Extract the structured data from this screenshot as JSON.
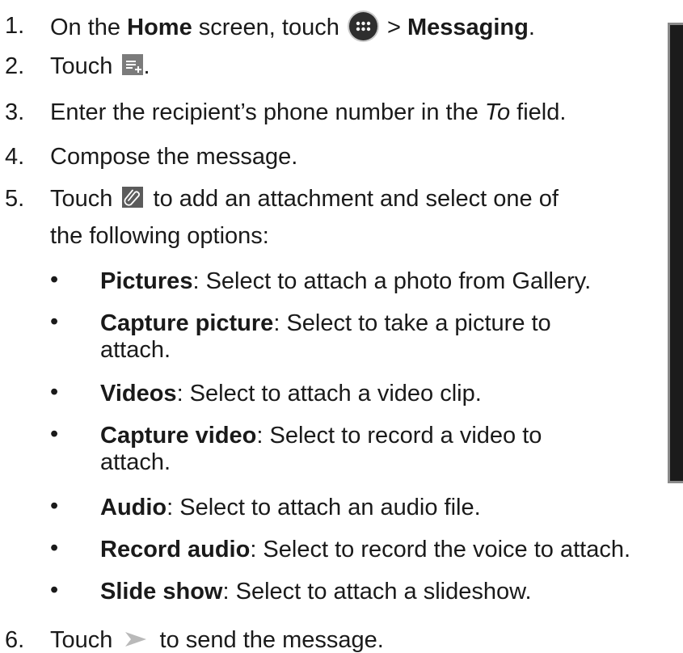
{
  "steps": [
    {
      "num": "1.",
      "pre": "On the ",
      "bold1": "Home",
      "mid": " screen, touch ",
      "after": " > ",
      "bold2": "Messaging",
      "end": "."
    },
    {
      "num": "2.",
      "pre": "Touch ",
      "end": "."
    },
    {
      "num": "3.",
      "pre": "Enter the recipient’s phone number in the ",
      "italic": "To",
      "end": " field."
    },
    {
      "num": "4.",
      "text": "Compose the message."
    },
    {
      "num": "5.",
      "pre": "Touch ",
      "post": " to add an attachment and select one of",
      "line2": "the following options:"
    },
    {
      "num": "6.",
      "pre": "Touch ",
      "post": " to send the message."
    }
  ],
  "bullet_char": "•",
  "options": [
    {
      "term": "Pictures",
      "desc": ": Select to attach a photo from Gallery."
    },
    {
      "term": "Capture picture",
      "desc": ": Select to take a picture to",
      "desc2": "attach."
    },
    {
      "term": "Videos",
      "desc": ": Select to attach a video clip."
    },
    {
      "term": "Capture video",
      "desc": ": Select to record a video to",
      "desc2": "attach."
    },
    {
      "term": "Audio",
      "desc": ": Select to attach an audio file."
    },
    {
      "term": "Record audio",
      "desc": ": Select to record the voice to attach."
    },
    {
      "term": "Slide show",
      "desc": ": Select to attach a slideshow."
    }
  ],
  "icons": {
    "step1": "apps-launcher-icon",
    "step2": "new-message-icon",
    "step5": "paperclip-attach-icon",
    "step6": "send-arrow-icon"
  }
}
